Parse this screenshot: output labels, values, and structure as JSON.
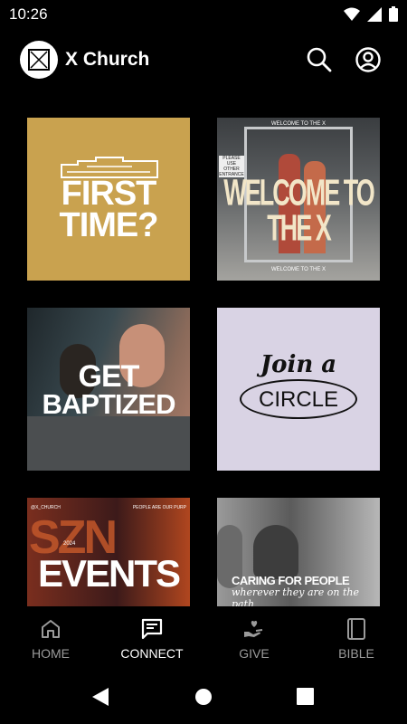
{
  "status": {
    "time": "10:26"
  },
  "header": {
    "title": "X Church"
  },
  "tiles": {
    "first_time": {
      "line1": "FIRST",
      "line2": "TIME?"
    },
    "welcome": {
      "headline": "WELCOME TO THE X",
      "sign_top": "WELCOME TO THE X",
      "door_sign": "PLEASE USE OTHER ENTRANCE",
      "caption": "WELCOME TO THE X"
    },
    "baptized": {
      "line1": "GET",
      "line2": "BAPTIZED"
    },
    "circle": {
      "script": "Join a",
      "word": "CIRCLE"
    },
    "events": {
      "handle": "@X_CHURCH",
      "tagline": "PEOPLE ARE OUR PURP",
      "year": "2024",
      "title": "EVENTS"
    },
    "caring": {
      "line1": "CARING FOR PEOPLE",
      "line2": "wherever they are on the path"
    }
  },
  "nav": [
    {
      "label": "HOME",
      "icon": "home-icon",
      "active": false
    },
    {
      "label": "CONNECT",
      "icon": "chat-icon",
      "active": true
    },
    {
      "label": "GIVE",
      "icon": "give-icon",
      "active": false
    },
    {
      "label": "BIBLE",
      "icon": "bible-icon",
      "active": false
    }
  ],
  "colors": {
    "background": "#000000",
    "first_time_gold": "#c9a24f",
    "circle_lavender": "#d9d3e4",
    "inactive_nav": "#9a9a9a"
  }
}
